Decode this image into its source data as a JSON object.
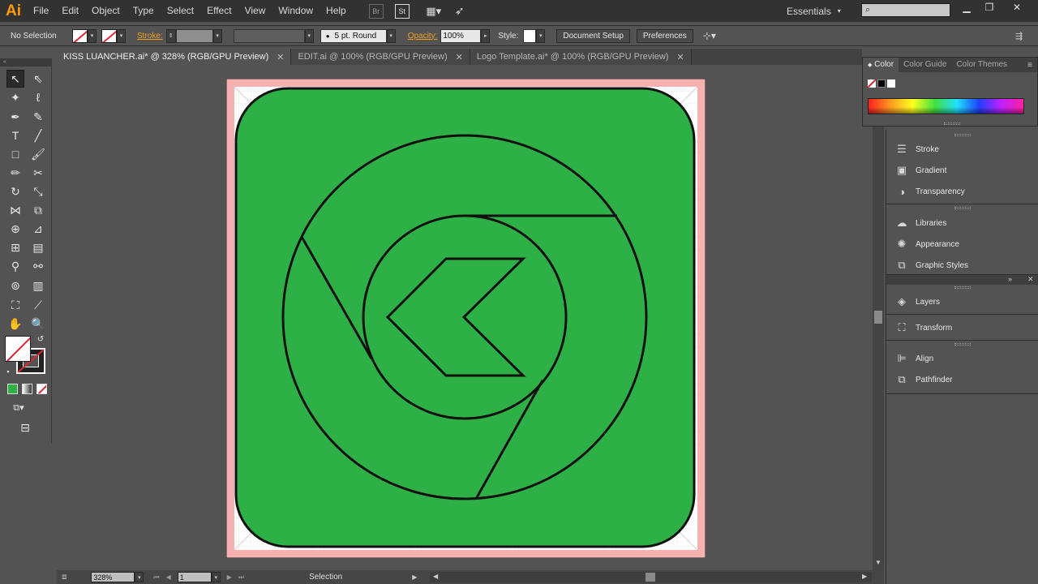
{
  "menubar": {
    "app_logo": "Ai",
    "items": [
      "File",
      "Edit",
      "Object",
      "Type",
      "Select",
      "Effect",
      "View",
      "Window",
      "Help"
    ],
    "icon_br": "Br",
    "icon_st": "St",
    "workspace": "Essentials"
  },
  "controlbar": {
    "selection_status": "No Selection",
    "stroke_label": "Stroke:",
    "brush_value": "5 pt. Round",
    "opacity_label": "Opacity:",
    "opacity_value": "100%",
    "style_label": "Style:",
    "document_setup": "Document Setup",
    "preferences": "Preferences"
  },
  "tabs": [
    {
      "label": "KISS LUANCHER.ai* @ 328% (RGB/GPU Preview)",
      "active": true
    },
    {
      "label": "EDIT.ai @ 100% (RGB/GPU Preview)",
      "active": false
    },
    {
      "label": "Logo Template.ai* @ 100% (RGB/GPU Preview)",
      "active": false
    }
  ],
  "color_panel": {
    "tabs": [
      "Color",
      "Color Guide",
      "Color Themes"
    ]
  },
  "dock": {
    "group1": [
      "Stroke",
      "Gradient",
      "Transparency"
    ],
    "group2": [
      "Libraries",
      "Appearance",
      "Graphic Styles"
    ],
    "group3": [
      "Layers",
      "Transform",
      "Align",
      "Pathfinder"
    ]
  },
  "statusbar": {
    "zoom": "328%",
    "artboard": "1",
    "tool": "Selection"
  },
  "colors": {
    "icon_fill": "#2db045",
    "stroke": "#111111",
    "bleed": "#f6b1b1",
    "accent": "#ff9a00"
  }
}
